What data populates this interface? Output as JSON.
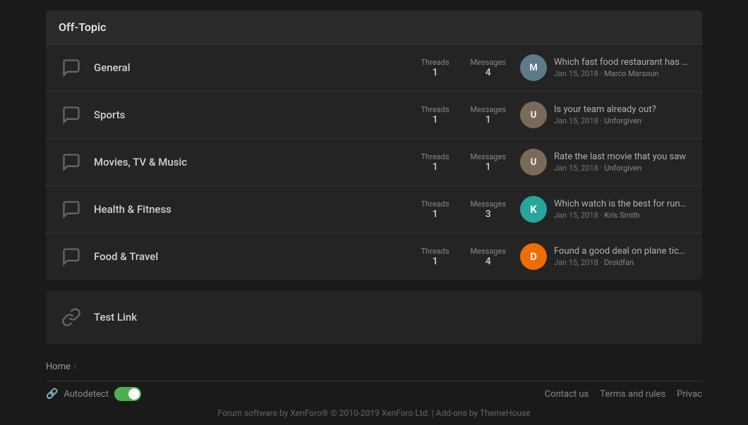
{
  "section": {
    "title": "Off-Topic",
    "forums": [
      {
        "id": "general",
        "name": "General",
        "threads": 1,
        "messages": 4,
        "latest_title": "Which fast food restaurant has the ...",
        "latest_date": "Jan 15, 2018",
        "latest_user": "Marco Marsoun",
        "avatar_type": "img",
        "avatar_initials": "M",
        "avatar_color": "#5d7a8a"
      },
      {
        "id": "sports",
        "name": "Sports",
        "threads": 1,
        "messages": 1,
        "latest_title": "Is your team already out?",
        "latest_date": "Jan 15, 2018",
        "latest_user": "Unforgiven",
        "avatar_type": "img",
        "avatar_initials": "U",
        "avatar_color": "#7a6a5a"
      },
      {
        "id": "movies",
        "name": "Movies, TV & Music",
        "threads": 1,
        "messages": 1,
        "latest_title": "Rate the last movie that you saw",
        "latest_date": "Jan 15, 2018",
        "latest_user": "Unforgiven",
        "avatar_type": "img",
        "avatar_initials": "U",
        "avatar_color": "#7a6a5a"
      },
      {
        "id": "health",
        "name": "Health & Fitness",
        "threads": 1,
        "messages": 3,
        "latest_title": "Which watch is the best for running?",
        "latest_date": "Jan 15, 2018",
        "latest_user": "Kris Smith",
        "avatar_type": "letter",
        "avatar_initials": "K",
        "avatar_color": "#26a69a"
      },
      {
        "id": "food",
        "name": "Food & Travel",
        "threads": 1,
        "messages": 4,
        "latest_title": "Found a good deal on plane tickets ...",
        "latest_date": "Jan 15, 2018",
        "latest_user": "Droidfan",
        "avatar_type": "letter",
        "avatar_initials": "D",
        "avatar_color": "#ef6c00"
      }
    ]
  },
  "test_link": {
    "name": "Test Link"
  },
  "breadcrumb": {
    "home_label": "Home"
  },
  "footer": {
    "autodetect_label": "Autodetect",
    "contact_label": "Contact us",
    "terms_label": "Terms and rules",
    "privacy_label": "Privac",
    "bottom_text": "Forum software by XenForo® © 2010-2019 XenForo Ltd. | Add-ons by ThemeHouse"
  },
  "labels": {
    "threads": "Threads",
    "messages": "Messages"
  }
}
